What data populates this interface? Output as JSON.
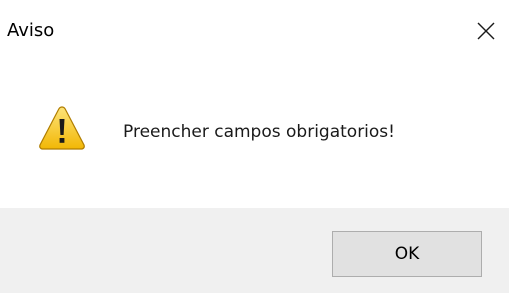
{
  "dialog": {
    "title": "Aviso",
    "message": "Preencher campos obrigatorios!",
    "ok_label": "OK",
    "icon": "warning-icon",
    "close_icon": "close-icon"
  },
  "colors": {
    "titlebar_bg": "#ffffff",
    "content_bg": "#ffffff",
    "footer_bg": "#f0f0f0",
    "button_bg": "#e1e1e1",
    "button_border": "#adadad",
    "warning_yellow": "#f5c518"
  }
}
